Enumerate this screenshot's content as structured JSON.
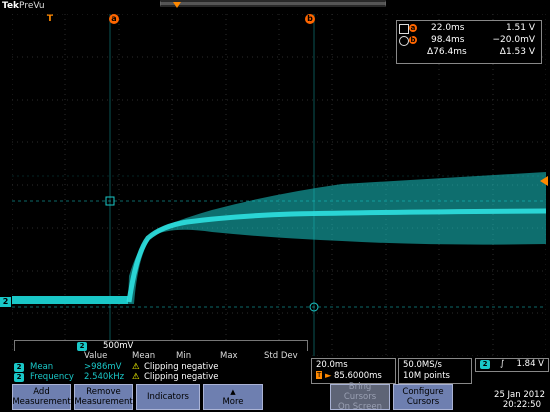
{
  "brand": {
    "name": "Tek",
    "mode": "PreVu"
  },
  "markers": {
    "trigger_pos": "T",
    "cursor_a": "a",
    "cursor_b": "b",
    "channel": "2"
  },
  "cursor_readout": {
    "a_time": "22.0ms",
    "a_val": "1.51 V",
    "b_time": "98.4ms",
    "b_val": "−20.0mV",
    "delta_time": "Δ76.4ms",
    "delta_val": "Δ1.53 V"
  },
  "channel_scale": {
    "channel": "2",
    "volts_div": "500mV"
  },
  "measurements": {
    "headers": [
      "Value",
      "Mean",
      "Min",
      "Max",
      "Std Dev"
    ],
    "rows": [
      {
        "channel": "2",
        "name": "Mean",
        "value": ">986mV",
        "status": "Clipping negative"
      },
      {
        "channel": "2",
        "name": "Frequency",
        "value": "2.540kHz",
        "status": "Clipping negative"
      }
    ]
  },
  "timebase": {
    "time_div": "20.0ms",
    "position": "85.6000ms"
  },
  "acquisition": {
    "sample_rate": "50.0MS/s",
    "record_length": "10M points"
  },
  "trigger": {
    "channel": "2",
    "slope_icon": "rising-edge-icon",
    "level": "1.84 V"
  },
  "datetime": {
    "date": "25 Jan  2012",
    "time": "20:22:50"
  },
  "buttons": [
    {
      "label_1": "Add",
      "label_2": "Measurement"
    },
    {
      "label_1": "Remove",
      "label_2": "Measurement"
    },
    {
      "label_1": "Indicators",
      "label_2": ""
    },
    {
      "label_1": "More",
      "label_2": ""
    },
    {
      "label_1": "Bring",
      "label_2": "Cursors",
      "label_3": "On Screen"
    },
    {
      "label_1": "Configure",
      "label_2": "Cursors"
    }
  ],
  "colors": {
    "trace": "#1ac8c8",
    "cursor": "#f60",
    "grid": "#3a3a3a",
    "button": "#6e7fb0"
  }
}
